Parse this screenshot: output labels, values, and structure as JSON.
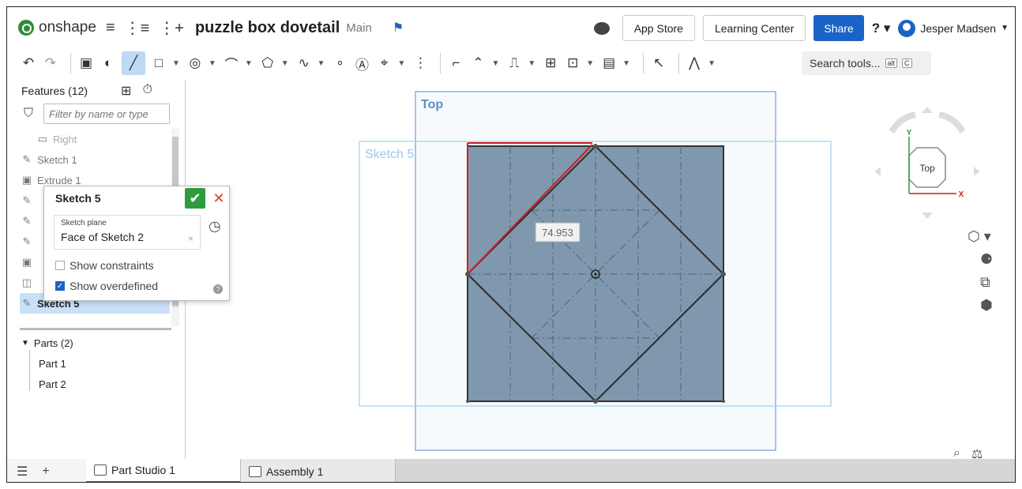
{
  "header": {
    "logo_text": "onshape",
    "document_title": "puzzle box dovetail",
    "branch": "Main",
    "buttons": {
      "app_store": "App Store",
      "learning_center": "Learning Center",
      "share": "Share"
    },
    "help_glyph": "?",
    "user_name": "Jesper Madsen"
  },
  "toolbar": {
    "search_label": "Search tools...",
    "shortcut_alt": "alt",
    "shortcut_key": "C"
  },
  "features": {
    "title": "Features (12)",
    "filter_placeholder": "Filter by name or type",
    "items": [
      {
        "label": "Right"
      },
      {
        "label": "Sketch 1"
      },
      {
        "label": "Extrude 1"
      },
      {
        "label": "Sketch 5"
      }
    ]
  },
  "parts": {
    "title": "Parts (2)",
    "items": [
      "Part 1",
      "Part 2"
    ]
  },
  "sketch_dialog": {
    "title": "Sketch 5",
    "plane_label": "Sketch plane",
    "plane_value": "Face of Sketch 2",
    "show_constraints": "Show constraints",
    "show_overdefined": "Show overdefined"
  },
  "canvas": {
    "plane_top_label": "Top",
    "sketch_label": "Sketch 5",
    "dimension_value": "74.953"
  },
  "viewcube": {
    "face_label": "Top",
    "axis_y": "Y",
    "axis_x": "X"
  },
  "tabs": [
    {
      "label": "Part Studio 1",
      "active": true
    },
    {
      "label": "Assembly 1",
      "active": false
    }
  ],
  "colors": {
    "brand_green": "#2e8b3a",
    "accent_blue": "#1a63c6",
    "sketch_fill": "#7f98ad",
    "overdefined_red": "#cc1f1f"
  }
}
